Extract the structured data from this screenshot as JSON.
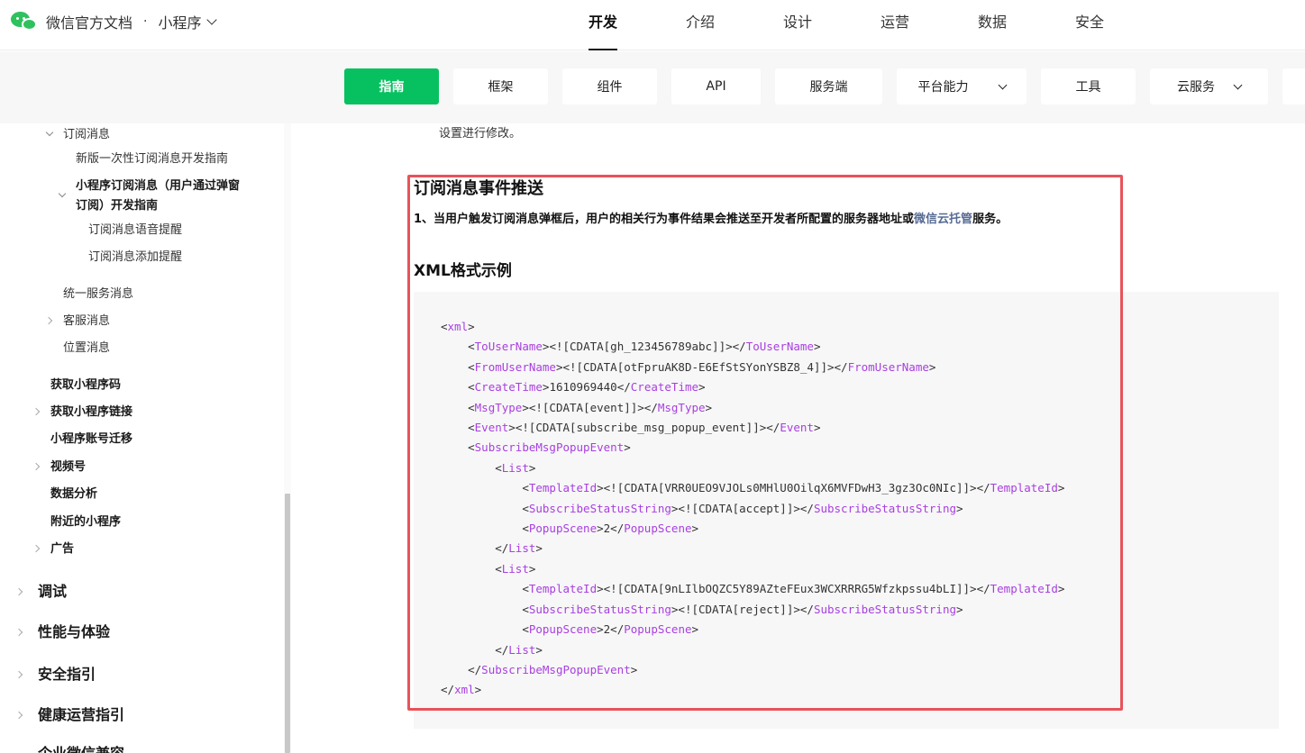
{
  "header": {
    "title": "微信官方文档",
    "separator": "·",
    "product": "小程序",
    "nav": [
      "开发",
      "介绍",
      "设计",
      "运营",
      "数据",
      "安全"
    ],
    "active_nav": "开发"
  },
  "subnav": {
    "guide": "指南",
    "framework": "框架",
    "components": "组件",
    "api": "API",
    "server": "服务端",
    "platform": "平台能力",
    "tools": "工具",
    "cloud": "云服务"
  },
  "sidebar": {
    "subscribe_msg": "订阅消息",
    "new_onetime": "新版一次性订阅消息开发指南",
    "mp_subscribe_line1": "小程序订阅消息（用户通过弹窗",
    "mp_subscribe_line2": "订阅）开发指南",
    "voice_remind": "订阅消息语音提醒",
    "add_remind": "订阅消息添加提醒",
    "unified_msg": "统一服务消息",
    "kefu_msg": "客服消息",
    "location_msg": "位置消息",
    "get_code": "获取小程序码",
    "get_link": "获取小程序链接",
    "account_migrate": "小程序账号迁移",
    "channels": "视频号",
    "data_analysis": "数据分析",
    "nearby": "附近的小程序",
    "ads": "广告",
    "debug": "调试",
    "performance": "性能与体验",
    "security_guide": "安全指引",
    "health_ops": "健康运营指引",
    "cut_off": "企业微信兼容"
  },
  "content": {
    "prev_text": "设置进行修改。",
    "heading": "订阅消息事件推送",
    "para_prefix": "1、当用户触发订阅消息弹框后，用户的相关行为事件结果会推送至开发者所配置的服务器地址或",
    "para_link": "微信云托管",
    "para_suffix": "服务。",
    "subheading": "XML格式示例",
    "code_lines": [
      {
        "indent": 0,
        "open": "xml",
        "text": "",
        "close": ""
      },
      {
        "indent": 1,
        "open": "ToUserName",
        "text": "<![CDATA[gh_123456789abc]]>",
        "close": "ToUserName"
      },
      {
        "indent": 1,
        "open": "FromUserName",
        "text": "<![CDATA[otFpruAK8D-E6EfStSYonYSBZ8_4]]>",
        "close": "FromUserName"
      },
      {
        "indent": 1,
        "open": "CreateTime",
        "text": "1610969440",
        "close": "CreateTime"
      },
      {
        "indent": 1,
        "open": "MsgType",
        "text": "<![CDATA[event]]>",
        "close": "MsgType"
      },
      {
        "indent": 1,
        "open": "Event",
        "text": "<![CDATA[subscribe_msg_popup_event]]>",
        "close": "Event"
      },
      {
        "indent": 1,
        "open": "SubscribeMsgPopupEvent",
        "text": "",
        "close": ""
      },
      {
        "indent": 2,
        "open": "List",
        "text": "",
        "close": ""
      },
      {
        "indent": 3,
        "open": "TemplateId",
        "text": "<![CDATA[VRR0UEO9VJOLs0MHlU0OilqX6MVFDwH3_3gz3Oc0NIc]]>",
        "close": "TemplateId"
      },
      {
        "indent": 3,
        "open": "SubscribeStatusString",
        "text": "<![CDATA[accept]]>",
        "close": "SubscribeStatusString"
      },
      {
        "indent": 3,
        "open": "PopupScene",
        "text": "2",
        "close": "PopupScene"
      },
      {
        "indent": 2,
        "open": "",
        "text": "",
        "close": "List"
      },
      {
        "indent": 2,
        "open": "List",
        "text": "",
        "close": ""
      },
      {
        "indent": 3,
        "open": "TemplateId",
        "text": "<![CDATA[9nLIlbOQZC5Y89AZteFEux3WCXRRRG5Wfzkpssu4bLI]]>",
        "close": "TemplateId"
      },
      {
        "indent": 3,
        "open": "SubscribeStatusString",
        "text": "<![CDATA[reject]]>",
        "close": "SubscribeStatusString"
      },
      {
        "indent": 3,
        "open": "PopupScene",
        "text": "2",
        "close": "PopupScene"
      },
      {
        "indent": 2,
        "open": "",
        "text": "",
        "close": "List"
      },
      {
        "indent": 1,
        "open": "",
        "text": "",
        "close": "SubscribeMsgPopupEvent"
      },
      {
        "indent": 0,
        "open": "",
        "text": "",
        "close": "xml"
      }
    ]
  },
  "colors": {
    "accent": "#07c160",
    "tag": "#a83fe0",
    "link": "#576b95",
    "highlight": "#e8535a"
  }
}
